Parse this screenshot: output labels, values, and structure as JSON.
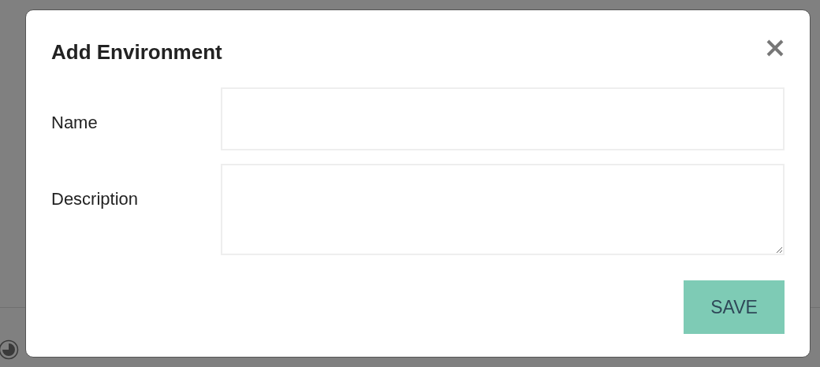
{
  "dialog": {
    "title": "Add Environment",
    "fields": [
      {
        "kind": "input",
        "label": "Name"
      },
      {
        "kind": "textarea",
        "label": "Description"
      }
    ],
    "save_button": "SAVE"
  }
}
